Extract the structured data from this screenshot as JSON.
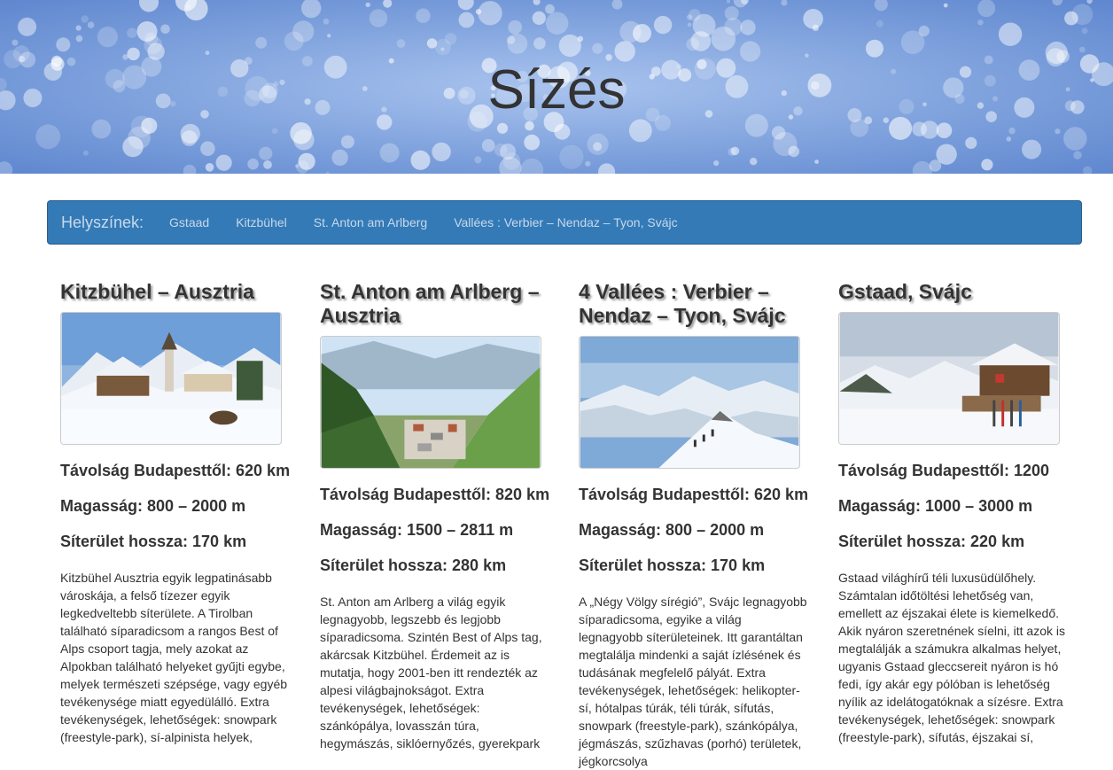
{
  "header": {
    "title": "Sízés"
  },
  "nav": {
    "brand": "Helyszínek:",
    "links": [
      "Gstaad",
      "Kitzbühel",
      "St. Anton am Arlberg",
      "Vallées : Verbier – Nendaz – Tyon, Svájc"
    ]
  },
  "resorts": [
    {
      "title": "Kitzbühel – Ausztria",
      "distance": "Távolság Budapesttől: 620 km",
      "altitude": "Magasság: 800 – 2000 m",
      "slopes": "Síterület hossza: 170 km",
      "description": "Kitzbühel Ausztria egyik legpatinásabb városkája, a felső tízezer egyik legkedveltebb síterülete. A Tirolban található síparadicsom a rangos Best of Alps csoport tagja, mely azokat az Alpokban található helyeket gyűjti egybe, melyek természeti szépsége, vagy egyéb tevékenysége miatt egyedülálló. Extra tevékenységek, lehetőségek: snowpark (freestyle-park), sí-alpinista helyek,"
    },
    {
      "title": "St. Anton am Arlberg – Ausztria",
      "distance": "Távolság Budapesttől: 820 km",
      "altitude": "Magasság: 1500 – 2811 m",
      "slopes": "Síterület hossza: 280 km",
      "description": "St. Anton am Arlberg a világ egyik legnagyobb, legszebb és legjobb síparadicsoma. Szintén Best of Alps tag, akárcsak Kitzbühel. Érdemeit az is mutatja, hogy 2001-ben itt rendezték az alpesi világbajnokságot. Extra tevékenységek, lehetőségek: szánkópálya, lovasszán túra, hegymászás, siklóernyőzés, gyerekpark"
    },
    {
      "title": "4 Vallées : Verbier – Nendaz – Tyon, Svájc",
      "distance": "Távolság Budapesttől: 620 km",
      "altitude": "Magasság: 800 – 2000 m",
      "slopes": "Síterület hossza: 170 km",
      "description": "A „Négy Völgy sírégió”, Svájc legnagyobb síparadicsoma, egyike a világ legnagyobb síterületeinek. Itt garantáltan megtalálja mindenki a saját ízlésének és tudásának megfelelő pályát. Extra tevékenységek, lehetőségek: helikopter-sí, hótalpas túrák, téli túrák, sífutás, snowpark (freestyle-park), szánkópálya, jégmászás, szűzhavas (porhó) területek, jégkorcsolya"
    },
    {
      "title": "Gstaad, Svájc",
      "distance": "Távolság Budapesttől: 1200",
      "altitude": "Magasság: 1000 – 3000 m",
      "slopes": "Síterület hossza: 220 km",
      "description": "Gstaad világhírű téli luxusüdülőhely. Számtalan időtöltési lehetőség van, emellett az éjszakai élete is kiemelkedő. Akik nyáron szeretnének síelni, itt azok is megtalálják a számukra alkalmas helyet, ugyanis Gstaad gleccsereit nyáron is hó fedi, így akár egy pólóban is lehetőség nyílik az idelátogatóknak a sízésre. Extra tevékenységek, lehetőségek: snowpark (freestyle-park), sífutás, éjszakai sí,"
    }
  ]
}
